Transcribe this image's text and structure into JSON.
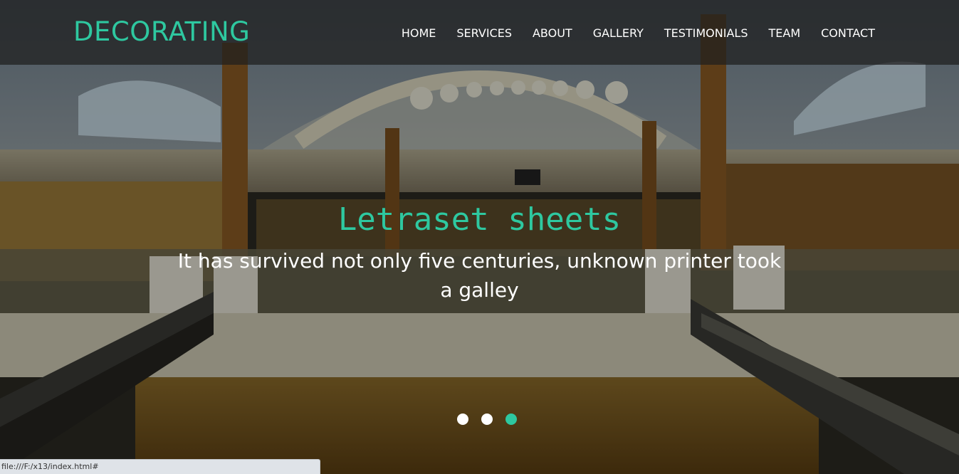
{
  "brand": "DECORATING",
  "nav": {
    "items": [
      "HOME",
      "SERVICES",
      "ABOUT",
      "GALLERY",
      "TESTIMONIALS",
      "TEAM",
      "CONTACT"
    ]
  },
  "slide": {
    "title": "Letraset sheets",
    "text_line1": "It has survived not only five centuries, unknown printer took",
    "text_line2": "a galley"
  },
  "carousel": {
    "slide_count": 3,
    "active_index": 2
  },
  "status_bar": "file:///F:/x13/index.html#",
  "colors": {
    "accent": "#2ec8a0",
    "nav_text": "#ffffff",
    "navbar_bg": "#1e1e1e"
  }
}
